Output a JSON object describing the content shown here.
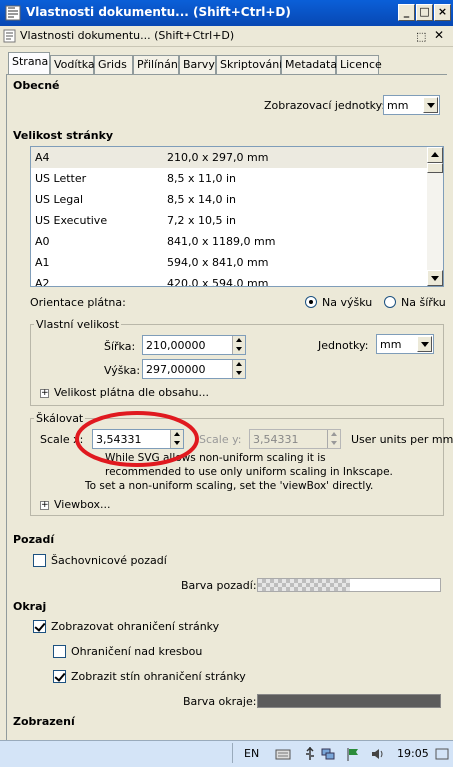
{
  "window": {
    "title": "Vlastnosti dokumentu... (Shift+Ctrl+D)",
    "subtitle": "Vlastnosti dokumentu... (Shift+Ctrl+D)",
    "controls": [
      "_",
      "□",
      "×"
    ]
  },
  "tabs": [
    "Strana",
    "Vodítka",
    "Grids",
    "Přilínání",
    "Barvy",
    "Skriptování",
    "Metadata",
    "Licence"
  ],
  "general": {
    "heading": "Obecné",
    "display_units_label": "Zobrazovací jednotky:",
    "display_units_value": "mm"
  },
  "page_size": {
    "heading": "Velikost stránky",
    "rows": [
      {
        "name": "A4",
        "size": "210,0 x 297,0 mm"
      },
      {
        "name": "US Letter",
        "size": "8,5 x 11,0 in"
      },
      {
        "name": "US Legal",
        "size": "8,5 x 14,0 in"
      },
      {
        "name": "US Executive",
        "size": "7,2 x 10,5 in"
      },
      {
        "name": "A0",
        "size": "841,0 x 1189,0 mm"
      },
      {
        "name": "A1",
        "size": "594,0 x 841,0 mm"
      },
      {
        "name": "A2",
        "size": "420,0 x 594,0 mm"
      }
    ]
  },
  "orientation": {
    "label": "Orientace plátna:",
    "portrait": "Na výšku",
    "landscape": "Na šířku",
    "selected": "portrait"
  },
  "custom_size": {
    "heading": "Vlastní velikost",
    "width_label": "Šířka:",
    "width_value": "210,00000",
    "height_label": "Výška:",
    "height_value": "297,00000",
    "units_label": "Jednotky:",
    "units_value": "mm",
    "resize_label": "Velikost plátna dle obsahu..."
  },
  "scale": {
    "heading": "Škálovat",
    "scale_x_label": "Scale x:",
    "scale_x_value": "3,54331",
    "scale_y_label": "Scale y:",
    "scale_y_value": "3,54331",
    "units_label": "User units per mm.",
    "note_line1": "While SVG allows non-uniform scaling it is",
    "note_line2": "recommended to use only uniform scaling in Inkscape.",
    "note_line3": "To set a non-uniform scaling, set the 'viewBox' directly.",
    "viewbox_label": "Viewbox...",
    "highlight_color": "#e0191f"
  },
  "background": {
    "heading": "Pozadí",
    "checkerboard_label": "Šachovnicové pozadí",
    "checkerboard_checked": false,
    "color_label": "Barva pozadí:"
  },
  "border": {
    "heading": "Okraj",
    "show_border_label": "Zobrazovat ohraničení stránky",
    "show_border_checked": true,
    "border_on_top_label": "Ohraničení nad kresbou",
    "border_on_top_checked": false,
    "shadow_label": "Zobrazit stín ohraničení stránky",
    "shadow_checked": true,
    "color_label": "Barva okraje:",
    "color_value": "#5c5c5c"
  },
  "display": {
    "heading": "Zobrazení"
  },
  "taskbar": {
    "language": "EN",
    "time": "19:05"
  }
}
